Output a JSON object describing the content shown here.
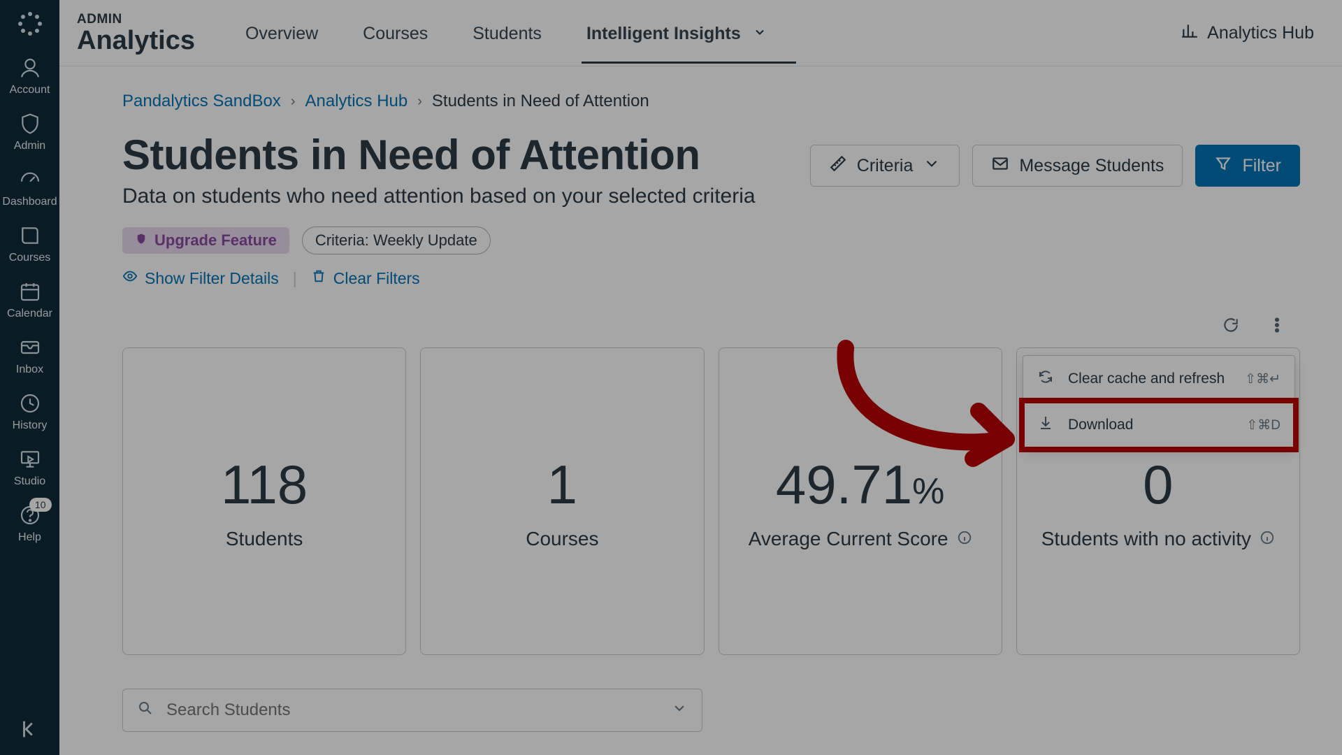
{
  "nav": {
    "items": [
      {
        "label": "Account"
      },
      {
        "label": "Admin"
      },
      {
        "label": "Dashboard"
      },
      {
        "label": "Courses"
      },
      {
        "label": "Calendar"
      },
      {
        "label": "Inbox"
      },
      {
        "label": "History"
      },
      {
        "label": "Studio"
      },
      {
        "label": "Help",
        "badge": "10"
      }
    ]
  },
  "brand": {
    "small": "ADMIN",
    "big": "Analytics"
  },
  "tabs": {
    "overview": "Overview",
    "courses": "Courses",
    "students": "Students",
    "insights": "Intelligent Insights"
  },
  "hub_link": "Analytics Hub",
  "breadcrumb": {
    "a": "Pandalytics SandBox",
    "b": "Analytics Hub",
    "c": "Students in Need of Attention"
  },
  "page": {
    "title": "Students in Need of Attention",
    "subtitle": "Data on students who need attention based on your selected criteria"
  },
  "actions": {
    "criteria": "Criteria",
    "message": "Message Students",
    "filter": "Filter"
  },
  "chips": {
    "upgrade": "Upgrade Feature",
    "criteria": "Criteria: Weekly Update"
  },
  "links": {
    "show": "Show Filter Details",
    "clear": "Clear Filters"
  },
  "popover": {
    "clear": "Clear cache and refresh",
    "clear_kbd": "⇧⌘↵",
    "download": "Download",
    "download_kbd": "⇧⌘D"
  },
  "cards": [
    {
      "value": "118",
      "label": "Students",
      "info": false
    },
    {
      "value": "1",
      "label": "Courses",
      "info": false
    },
    {
      "value": "49.71",
      "suffix": "%",
      "label": "Average Current Score",
      "info": true
    },
    {
      "value": "0",
      "label": "Students with no activity",
      "info": true
    }
  ],
  "search": {
    "placeholder": "Search Students"
  }
}
